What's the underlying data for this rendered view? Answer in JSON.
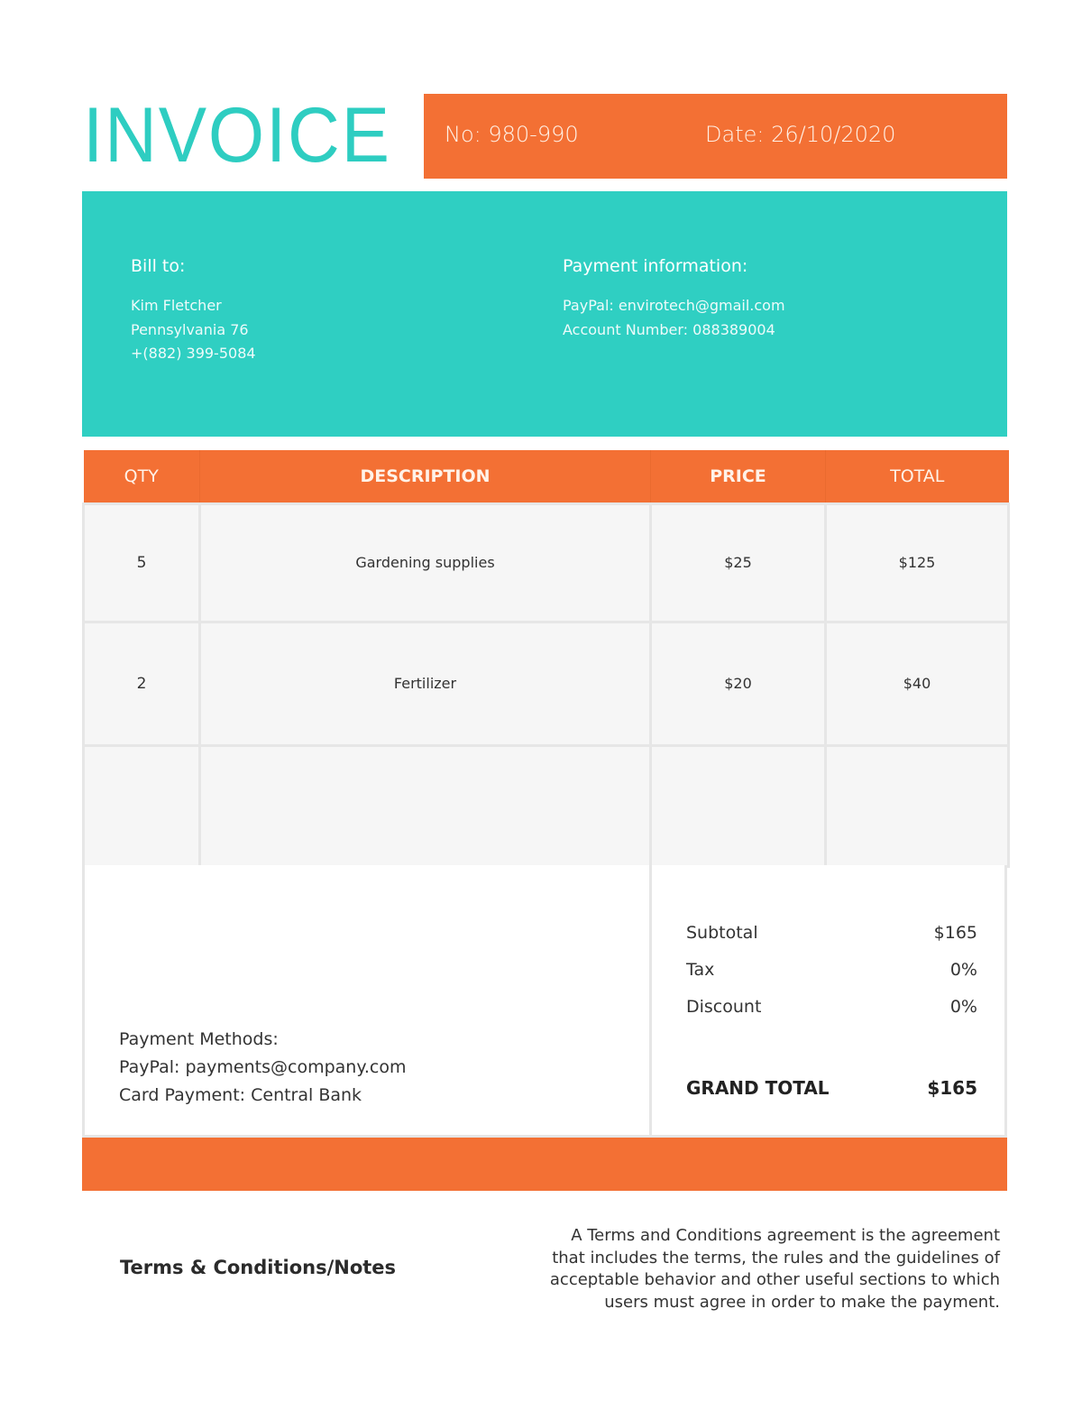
{
  "header": {
    "title": "INVOICE",
    "number": "No: 980-990",
    "date": "Date: 26/10/2020"
  },
  "bill_to": {
    "heading": "Bill to:",
    "name": "Kim Fletcher",
    "address": "Pennsylvania 76",
    "phone": "+(882) 399-5084"
  },
  "payment_info": {
    "heading": "Payment information:",
    "paypal": "PayPal: envirotech@gmail.com",
    "account": "Account Number: 088389004"
  },
  "table": {
    "columns": [
      "QTY",
      "DESCRIPTION",
      "PRICE",
      "TOTAL"
    ],
    "rows": [
      {
        "qty": "5",
        "description": "Gardening supplies",
        "price": "$25",
        "total": "$125"
      },
      {
        "qty": "2",
        "description": "Fertilizer",
        "price": "$20",
        "total": "$40"
      },
      {
        "qty": "",
        "description": "",
        "price": "",
        "total": ""
      }
    ]
  },
  "payment_methods": {
    "heading": "Payment Methods:",
    "paypal": "PayPal: payments@company.com",
    "card": "Card Payment: Central Bank"
  },
  "totals": {
    "subtotal_label": "Subtotal",
    "subtotal_value": "$165",
    "tax_label": "Tax",
    "tax_value": "0%",
    "discount_label": "Discount",
    "discount_value": "0%",
    "grand_label": "GRAND TOTAL",
    "grand_value": "$165"
  },
  "terms": {
    "title": "Terms & Conditions/Notes",
    "lines": [
      "A Terms and Conditions agreement is the agreement",
      "that includes the terms, the rules and the guidelines of",
      "acceptable behavior and other useful sections to which",
      "users must agree in order to make the payment."
    ]
  },
  "colors": {
    "accent_teal": "#2fcfc2",
    "accent_orange": "#f37034",
    "cell_background": "#f6f6f6",
    "grid_line": "#e6e6e6"
  }
}
